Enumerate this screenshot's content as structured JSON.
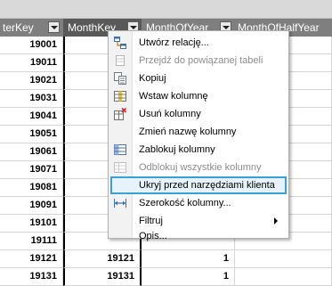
{
  "columns": [
    {
      "name": "terKey"
    },
    {
      "name": "MonthKey"
    },
    {
      "name": "MonthOfYear"
    },
    {
      "name": "MonthOfHalfYear"
    }
  ],
  "rows": [
    {
      "c1": "19001",
      "c2": "",
      "c3": "",
      "c4": ""
    },
    {
      "c1": "19011",
      "c2": "",
      "c3": "",
      "c4": ""
    },
    {
      "c1": "19021",
      "c2": "",
      "c3": "",
      "c4": ""
    },
    {
      "c1": "19031",
      "c2": "",
      "c3": "",
      "c4": ""
    },
    {
      "c1": "19041",
      "c2": "",
      "c3": "",
      "c4": ""
    },
    {
      "c1": "19051",
      "c2": "",
      "c3": "",
      "c4": ""
    },
    {
      "c1": "19061",
      "c2": "",
      "c3": "",
      "c4": ""
    },
    {
      "c1": "19071",
      "c2": "",
      "c3": "",
      "c4": ""
    },
    {
      "c1": "19081",
      "c2": "",
      "c3": "",
      "c4": ""
    },
    {
      "c1": "19091",
      "c2": "",
      "c3": "",
      "c4": ""
    },
    {
      "c1": "19101",
      "c2": "",
      "c3": "",
      "c4": ""
    },
    {
      "c1": "19111",
      "c2": "",
      "c3": "",
      "c4": ""
    },
    {
      "c1": "19121",
      "c2": "19121",
      "c3": "1",
      "c4": ""
    },
    {
      "c1": "19131",
      "c2": "19131",
      "c3": "1",
      "c4": ""
    }
  ],
  "context_menu": {
    "items": [
      {
        "label": "Utwórz relację...",
        "icon": "create-relationship-icon",
        "disabled": false
      },
      {
        "label": "Przejdź do powiązanej tabeli",
        "icon": "related-table-icon",
        "disabled": true
      },
      {
        "label": "Kopiuj",
        "icon": "copy-icon",
        "disabled": false
      },
      {
        "label": "Wstaw kolumnę",
        "icon": "insert-column-icon",
        "disabled": false
      },
      {
        "label": "Usuń kolumny",
        "icon": "delete-column-icon",
        "disabled": false
      },
      {
        "label": "Zmień nazwę kolumny",
        "icon": "",
        "disabled": false
      },
      {
        "label": "Zablokuj kolumny",
        "icon": "freeze-columns-icon",
        "disabled": false
      },
      {
        "label": "Odblokuj wszystkie kolumny",
        "icon": "unfreeze-columns-icon",
        "disabled": true
      },
      {
        "label": "Ukryj przed narzędziami klienta",
        "icon": "",
        "disabled": false,
        "highlighted": true
      },
      {
        "label": "Szerokość kolumny...",
        "icon": "column-width-icon",
        "disabled": false
      },
      {
        "label": "Filtruj",
        "icon": "",
        "disabled": false,
        "submenu": true
      },
      {
        "label": "Opis...",
        "icon": "",
        "disabled": false
      }
    ]
  },
  "colors": {
    "header_bg": "#7f7f7f",
    "highlight_border": "#3aa0d8",
    "highlight_bg": "#e6f3fb"
  }
}
